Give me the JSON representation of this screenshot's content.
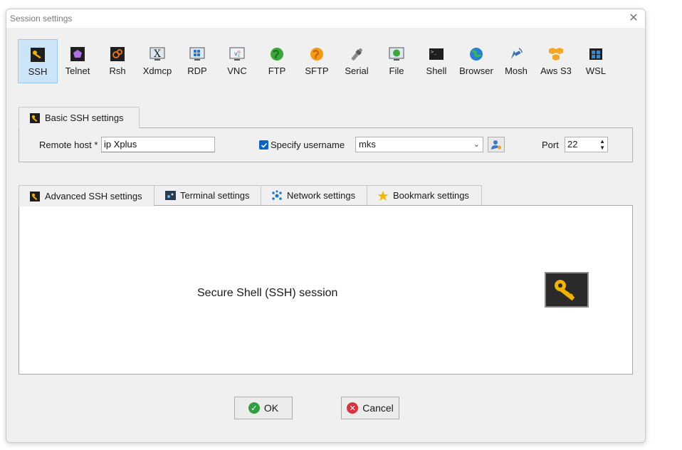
{
  "window": {
    "title": "Session settings"
  },
  "session_types": [
    {
      "label": "SSH",
      "icon": "ssh-icon",
      "selected": true
    },
    {
      "label": "Telnet",
      "icon": "telnet-icon"
    },
    {
      "label": "Rsh",
      "icon": "rsh-icon"
    },
    {
      "label": "Xdmcp",
      "icon": "xdmcp-icon"
    },
    {
      "label": "RDP",
      "icon": "rdp-icon"
    },
    {
      "label": "VNC",
      "icon": "vnc-icon"
    },
    {
      "label": "FTP",
      "icon": "ftp-icon"
    },
    {
      "label": "SFTP",
      "icon": "sftp-icon"
    },
    {
      "label": "Serial",
      "icon": "serial-icon"
    },
    {
      "label": "File",
      "icon": "file-icon"
    },
    {
      "label": "Shell",
      "icon": "shell-icon"
    },
    {
      "label": "Browser",
      "icon": "browser-icon"
    },
    {
      "label": "Mosh",
      "icon": "mosh-icon"
    },
    {
      "label": "Aws S3",
      "icon": "aws-s3-icon"
    },
    {
      "label": "WSL",
      "icon": "wsl-icon"
    }
  ],
  "basic": {
    "tab_label": "Basic SSH settings",
    "remote_host_label": "Remote host *",
    "remote_host_value": "ip Xplus",
    "specify_username_label": "Specify username",
    "specify_username_checked": true,
    "username_value": "mks",
    "port_label": "Port",
    "port_value": "22"
  },
  "advanced_tabs": [
    {
      "label": "Advanced SSH settings",
      "icon": "wrench-icon"
    },
    {
      "label": "Terminal settings",
      "icon": "terminal-icon"
    },
    {
      "label": "Network settings",
      "icon": "network-icon"
    },
    {
      "label": "Bookmark settings",
      "icon": "star-icon"
    }
  ],
  "content": {
    "description": "Secure Shell (SSH) session"
  },
  "buttons": {
    "ok_label": "OK",
    "cancel_label": "Cancel"
  },
  "colors": {
    "selected_bg": "#cce4f7",
    "checkbox": "#0a64c8",
    "ok_icon": "#2ea043",
    "cancel_icon": "#d9333f",
    "key": "#f0b400"
  }
}
